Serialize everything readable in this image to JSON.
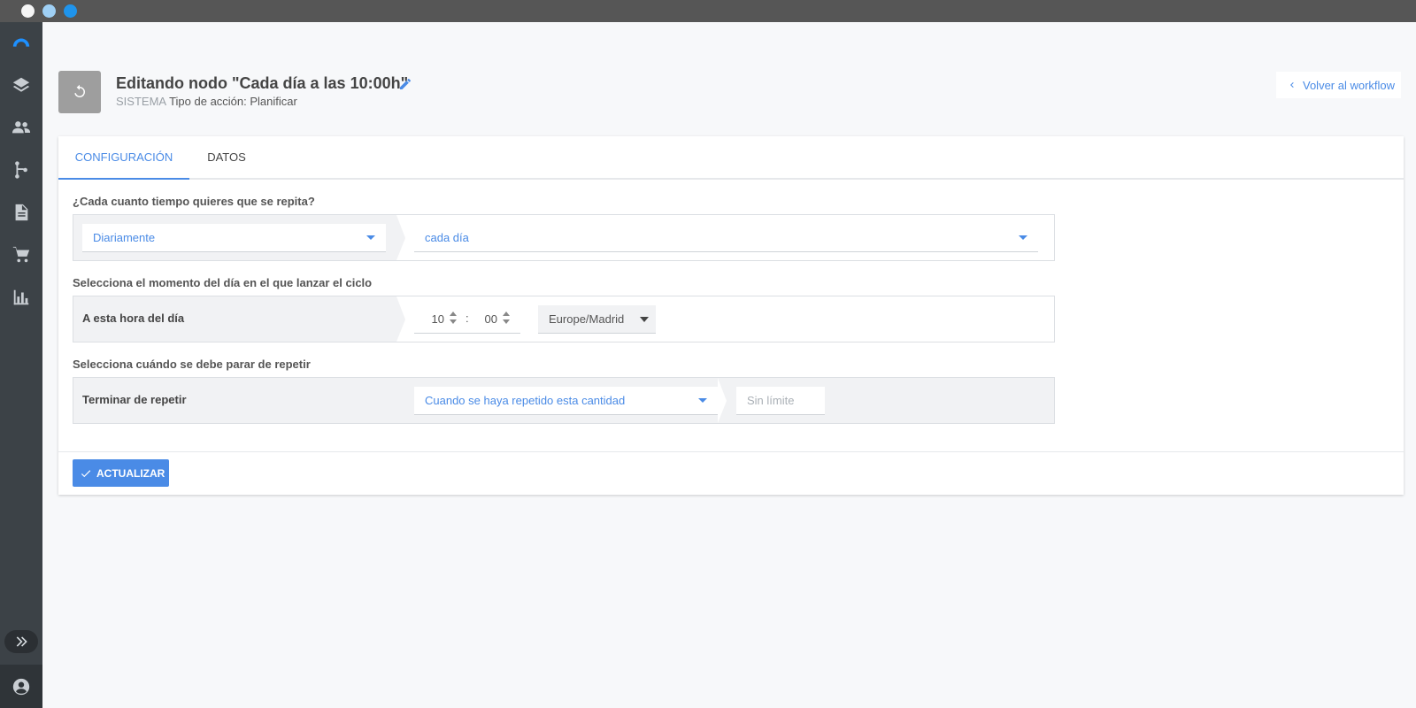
{
  "header": {
    "title": "Editando nodo \"Cada día a las 10:00h\"",
    "system_tag": "SISTEMA",
    "action_type": "Tipo de acción: Planificar",
    "back_button": "Volver al workflow"
  },
  "tabs": [
    {
      "label": "CONFIGURACIÓN",
      "active": true
    },
    {
      "label": "DATOS",
      "active": false
    }
  ],
  "sections": {
    "repeat": {
      "label": "¿Cada cuanto tiempo quieres que se repita?",
      "frequency_value": "Diariamente",
      "interval_value": "cada día"
    },
    "time": {
      "label": "Selecciona el momento del día en el que lanzar el ciclo",
      "row_label": "A esta hora del día",
      "hour": "10",
      "separator": ":",
      "minute": "00",
      "timezone": "Europe/Madrid"
    },
    "stop": {
      "label": "Selecciona cuándo se debe parar de repetir",
      "row_label": "Terminar de repetir",
      "condition_value": "Cuando se haya repetido esta cantidad",
      "limit_placeholder": "Sin límite"
    }
  },
  "footer": {
    "update_button": "ACTUALIZAR"
  },
  "colors": {
    "accent": "#4a8be6",
    "sidebar": "#3c4247",
    "titlebar": "#565656"
  },
  "icons": {
    "sidebar": [
      "logo-icon",
      "layers-icon",
      "people-icon",
      "workflow-icon",
      "document-icon",
      "cart-icon",
      "chart-icon",
      "expand-icon",
      "user-icon"
    ],
    "header": "loop-icon",
    "edit": "pencil-icon",
    "back": "chevron-left-icon",
    "update": "check-icon"
  }
}
